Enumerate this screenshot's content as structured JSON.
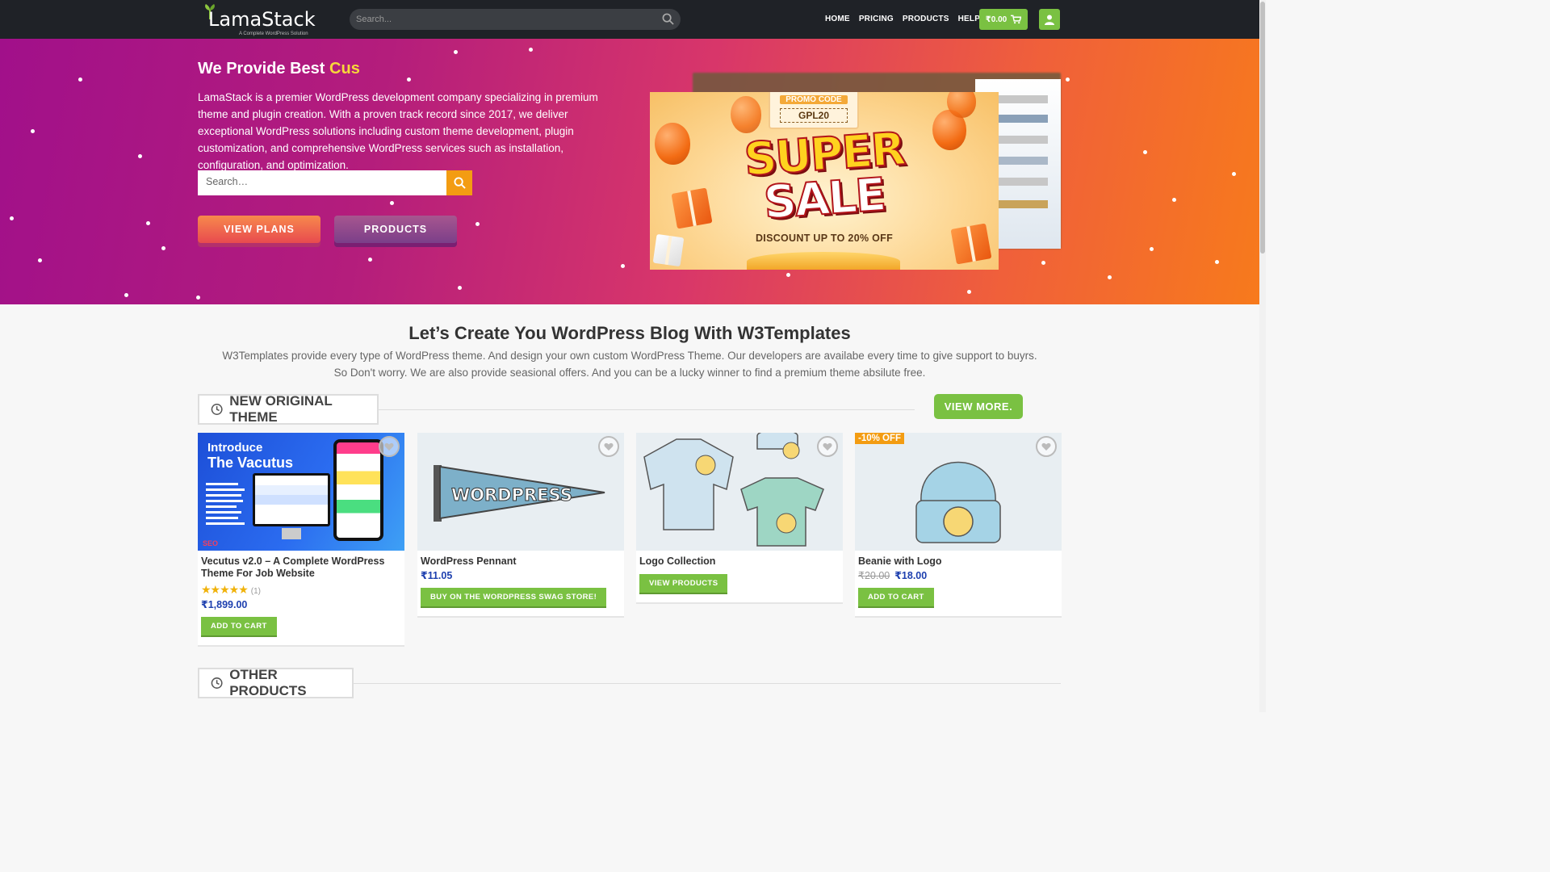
{
  "header": {
    "logo_main": "LamaStack",
    "logo_tagline": "A Complete WordPress Solution",
    "search_placeholder": "Search...",
    "nav": [
      "HOME",
      "PRICING",
      "PRODUCTS",
      "HELP"
    ],
    "cart_total": "₹0.00"
  },
  "hero": {
    "title_prefix": "We Provide Best ",
    "title_highlight": "Cus",
    "description": "LamaStack is a premier WordPress development company specializing in premium theme and plugin creation. With a proven track record since 2017, we deliver exceptional WordPress solutions including custom theme development, plugin customization, and comprehensive WordPress services such as installation, configuration, and optimization.",
    "search_placeholder": "Search…",
    "btn_plans": "VIEW PLANS",
    "btn_products": "PRODUCTS",
    "promo": {
      "code_label": "PROMO CODE",
      "code": "GPL20",
      "line1": "SUPER",
      "line2": "SALE",
      "discount": "DISCOUNT UP TO 20% OFF"
    }
  },
  "section": {
    "title": "Let’s Create You WordPress Blog With W3Templates",
    "description": "W3Templates provide every type of WordPress theme. And design your own custom WordPress Theme. Our developers are availabe every time to give support to buyrs. So Don't worry. We are also provide seasional offers. And you can be a lucky winner to find a premium theme absilute free.",
    "new_theme_heading": "NEW ORIGINAL THEME",
    "view_more": "VIEW MORE.",
    "other_heading": "OTHER PRODUCTS"
  },
  "products": [
    {
      "name": "Vecutus v2.0 – A Complete WordPress Theme For Job Website",
      "rating_count": "(1)",
      "price": "₹1,899.00",
      "button": "ADD TO CART",
      "img_title1": "Introduce",
      "img_title2": "The Vacutus"
    },
    {
      "name": "WordPress Pennant",
      "price": "₹11.05",
      "button": "BUY ON THE WORDPRESS SWAG STORE!",
      "pennant_text": "WORDPRESS"
    },
    {
      "name": "Logo Collection",
      "button": "VIEW PRODUCTS"
    },
    {
      "name": "Beanie with Logo",
      "old_price": "₹20.00",
      "price": "₹18.00",
      "button": "ADD TO CART",
      "badge": "-10% OFF"
    }
  ],
  "colors": {
    "accent_green": "#7ac142",
    "accent_orange": "#f39c12",
    "price_blue": "#1e40af"
  }
}
